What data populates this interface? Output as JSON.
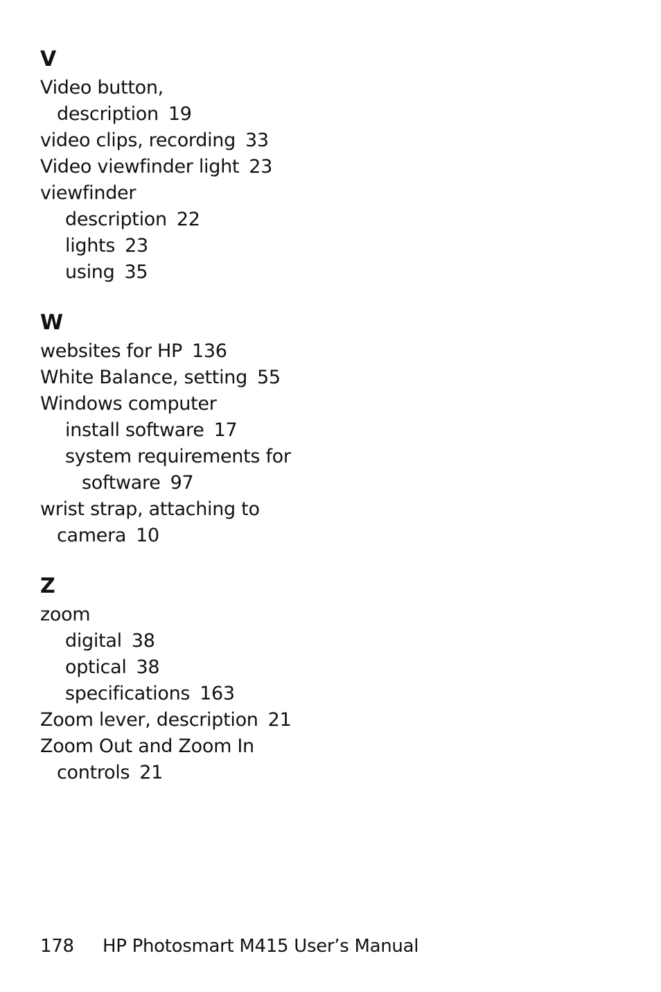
{
  "sections": [
    {
      "letter": "V",
      "entries": [
        {
          "level": 0,
          "text": "Video button,",
          "cont": "description",
          "page": "19"
        },
        {
          "level": 0,
          "text": "video clips, recording",
          "page": "33"
        },
        {
          "level": 0,
          "text": "Video viewfinder light",
          "page": "23"
        },
        {
          "level": 0,
          "text": "viewfinder"
        },
        {
          "level": 1,
          "text": "description",
          "page": "22"
        },
        {
          "level": 1,
          "text": "lights",
          "page": "23"
        },
        {
          "level": 1,
          "text": "using",
          "page": "35"
        }
      ]
    },
    {
      "letter": "W",
      "entries": [
        {
          "level": 0,
          "text": "websites for HP",
          "page": "136"
        },
        {
          "level": 0,
          "text": "White Balance, setting",
          "page": "55"
        },
        {
          "level": 0,
          "text": "Windows computer"
        },
        {
          "level": 1,
          "text": "install software",
          "page": "17"
        },
        {
          "level": 1,
          "text": "system requirements for",
          "cont": "software",
          "page": "97"
        },
        {
          "level": 0,
          "text": "wrist strap, attaching to",
          "cont": "camera",
          "page": "10"
        }
      ]
    },
    {
      "letter": "Z",
      "entries": [
        {
          "level": 0,
          "text": "zoom"
        },
        {
          "level": 1,
          "text": "digital",
          "page": "38"
        },
        {
          "level": 1,
          "text": "optical",
          "page": "38"
        },
        {
          "level": 1,
          "text": "specifications",
          "page": "163"
        },
        {
          "level": 0,
          "text": "Zoom lever, description",
          "page": "21"
        },
        {
          "level": 0,
          "text": "Zoom Out and Zoom In",
          "cont": "controls",
          "page": "21"
        }
      ]
    }
  ],
  "footer": {
    "page_number": "178",
    "title": "HP Photosmart M415 User’s Manual"
  }
}
